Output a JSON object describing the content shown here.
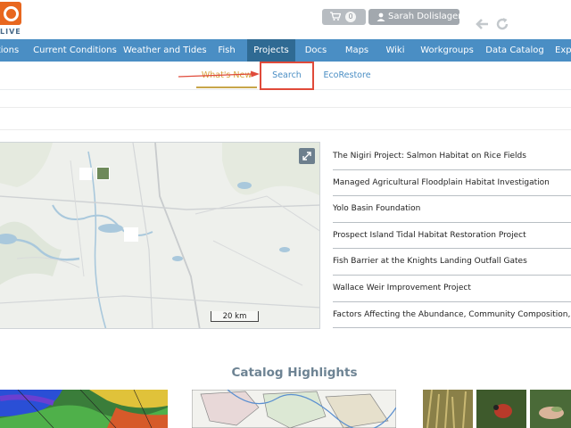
{
  "header": {
    "logo_text": "LIVE",
    "cart_count": "0",
    "user_name": "Sarah Dolislager",
    "icons": {
      "cart": "cart-icon",
      "user": "user-icon",
      "back": "arrow-left-icon",
      "refresh": "refresh-icon"
    }
  },
  "nav": {
    "items": [
      {
        "label": "tions"
      },
      {
        "label": "Current Conditions"
      },
      {
        "label": "Weather and Tides"
      },
      {
        "label": "Fish"
      },
      {
        "label": "Projects"
      },
      {
        "label": "Docs"
      },
      {
        "label": "Maps"
      },
      {
        "label": "Wiki"
      },
      {
        "label": "Workgroups"
      },
      {
        "label": "Data Catalog"
      },
      {
        "label": "Exp"
      }
    ],
    "active": "Projects",
    "colors": {
      "bar": "#4a8ec4",
      "active": "#2f6a93"
    }
  },
  "subnav": {
    "items": [
      {
        "label": "What's New"
      },
      {
        "label": "Search"
      },
      {
        "label": "EcoRestore"
      }
    ],
    "highlight_color": "#e04a3a"
  },
  "map": {
    "scale_label": "20 km",
    "expand_icon": "expand-icon"
  },
  "projects": [
    "The Nigiri Project: Salmon Habitat on Rice Fields",
    "Managed Agricultural Floodplain Habitat Investigation",
    "Yolo Basin Foundation",
    "Prospect Island Tidal Habitat Restoration Project",
    "Fish Barrier at the Knights Landing Outfall Gates",
    "Wallace Weir Improvement Project",
    "Factors Affecting the Abundance, Community Composition, Distrib"
  ],
  "catalog": {
    "title": "Catalog Highlights"
  }
}
